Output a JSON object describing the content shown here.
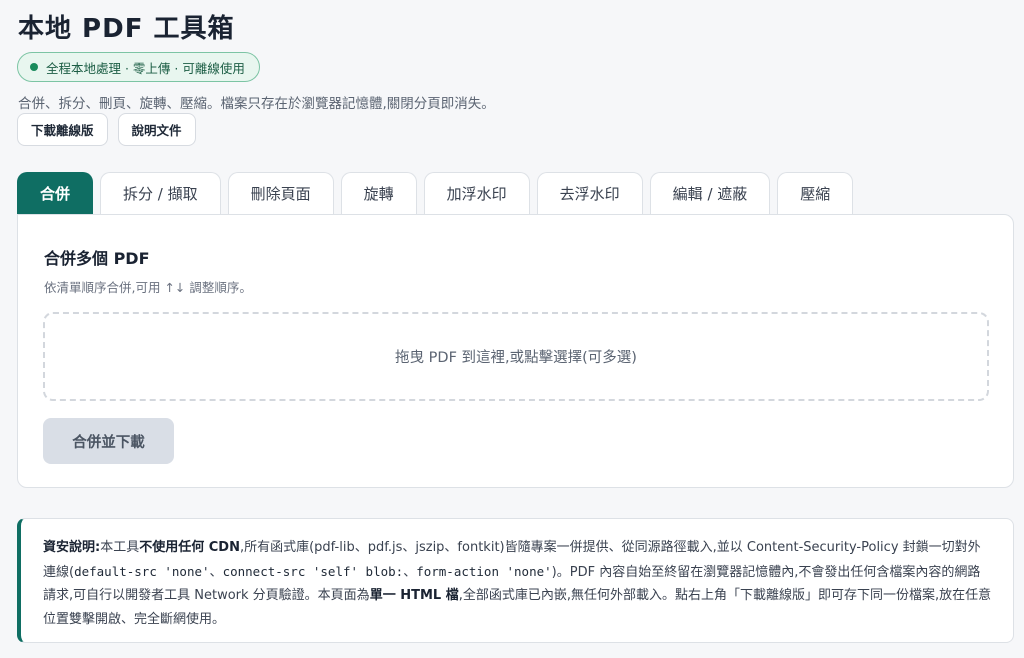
{
  "header": {
    "title": "本地 PDF 工具箱",
    "badge": "全程本地處理 · 零上傳 · 可離線使用",
    "subtitle": "合併、拆分、刪頁、旋轉、壓縮。檔案只存在於瀏覽器記憶體,關閉分頁即消失。",
    "buttons": {
      "download_offline": "下載離線版",
      "docs": "說明文件"
    }
  },
  "tabs": [
    {
      "label": "合併",
      "active": true
    },
    {
      "label": "拆分 / 擷取",
      "active": false
    },
    {
      "label": "刪除頁面",
      "active": false
    },
    {
      "label": "旋轉",
      "active": false
    },
    {
      "label": "加浮水印",
      "active": false
    },
    {
      "label": "去浮水印",
      "active": false
    },
    {
      "label": "編輯 / 遮蔽",
      "active": false
    },
    {
      "label": "壓縮",
      "active": false
    }
  ],
  "panel": {
    "title": "合併多個 PDF",
    "hint": "依清單順序合併,可用 ↑↓ 調整順序。",
    "dropzone": "拖曳 PDF 到這裡,或點擊選擇(可多選)",
    "action_button": "合併並下載"
  },
  "notice": {
    "p1": "資安說明:",
    "p2": "本工具",
    "p3": "不使用任何 CDN",
    "p4": ",所有函式庫(pdf-lib、pdf.js、jszip、fontkit)皆隨專案一併提供、從同源路徑載入,並以 Content-Security-Policy 封鎖一切對外連線(",
    "c1": "default-src 'none'",
    "p5": "、",
    "c2": "connect-src 'self' blob:",
    "p6": "、",
    "c3": "form-action 'none'",
    "p7": ")。PDF 內容自始至終留在瀏覽器記憶體內,不會發出任何含檔案內容的網路請求,可自行以開發者工具 Network 分頁驗證。本頁面為",
    "p8": "單一 HTML 檔",
    "p9": ",全部函式庫已內嵌,無任何外部載入。點右上角「下載離線版」即可存下同一份檔案,放在任意位置雙擊開啟、完全斷網使用。"
  },
  "colors": {
    "accent": "#0f6e63",
    "badge_bg": "#e8f6ef",
    "badge_dot": "#1a8b5c"
  }
}
